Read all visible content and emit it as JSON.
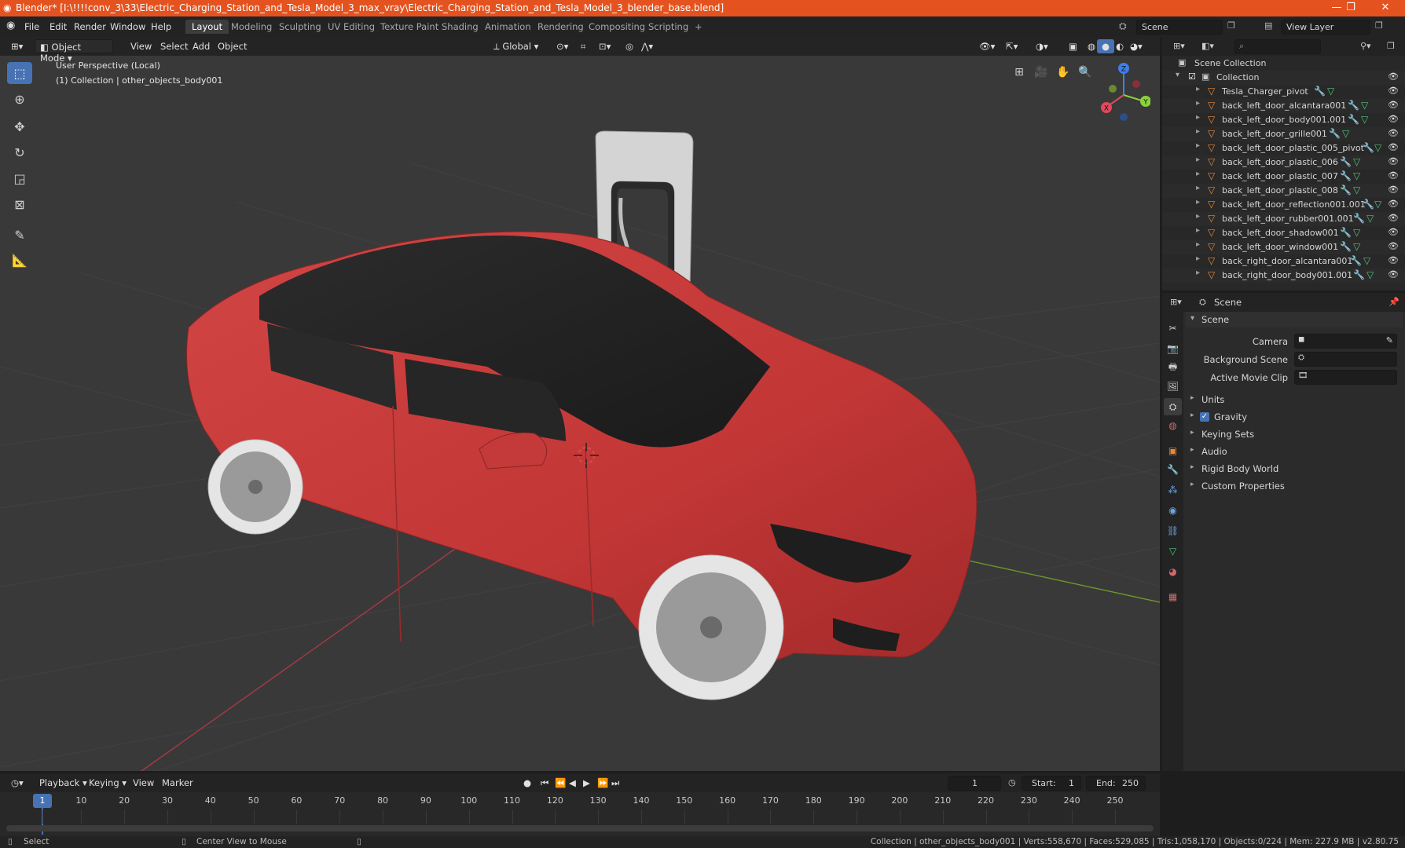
{
  "window": {
    "title": "Blender* [I:\\!!!!conv_3\\33\\Electric_Charging_Station_and_Tesla_Model_3_max_vray\\Electric_Charging_Station_and_Tesla_Model_3_blender_base.blend]",
    "minimize": "—",
    "maximize": "❐",
    "close": "✕"
  },
  "menu": {
    "items": [
      "File",
      "Edit",
      "Render",
      "Window",
      "Help"
    ],
    "workspaces": [
      "Layout",
      "Modeling",
      "Sculpting",
      "UV Editing",
      "Texture Paint",
      "Shading",
      "Animation",
      "Rendering",
      "Compositing",
      "Scripting"
    ],
    "add_tab": "+",
    "scene_label": "Scene",
    "view_layer_label": "View Layer"
  },
  "viewport": {
    "mode": "Object Mode",
    "menus": [
      "View",
      "Select",
      "Add",
      "Object"
    ],
    "transform_orientation": "Global",
    "perspective_label": "User Perspective (Local)",
    "collection_label": "(1) Collection | other_objects_body001",
    "gizmo_axes": {
      "x": "X",
      "y": "Y",
      "z": "Z"
    }
  },
  "outliner": {
    "root": "Scene Collection",
    "collection": "Collection",
    "objects": [
      "Tesla_Charger_pivot",
      "back_left_door_alcantara001",
      "back_left_door_body001.001",
      "back_left_door_grille001",
      "back_left_door_plastic_005_pivot",
      "back_left_door_plastic_006",
      "back_left_door_plastic_007",
      "back_left_door_plastic_008",
      "back_left_door_reflection001.001",
      "back_left_door_rubber001.001",
      "back_left_door_shadow001",
      "back_left_door_window001",
      "back_right_door_alcantara001",
      "back_right_door_body001.001"
    ]
  },
  "properties": {
    "header": "Scene",
    "panel_title": "Scene",
    "fields": {
      "camera": "Camera",
      "background_scene": "Background Scene",
      "active_movie_clip": "Active Movie Clip"
    },
    "sections": [
      "Units",
      "Gravity",
      "Keying Sets",
      "Audio",
      "Rigid Body World",
      "Custom Properties"
    ],
    "gravity_checked": true
  },
  "timeline": {
    "menus": [
      "Playback",
      "Keying",
      "View",
      "Marker"
    ],
    "current_frame": "1",
    "start_label": "Start:",
    "start": "1",
    "end_label": "End:",
    "end": "250",
    "ticks": [
      "1",
      "10",
      "20",
      "30",
      "40",
      "50",
      "60",
      "70",
      "80",
      "90",
      "100",
      "110",
      "120",
      "130",
      "140",
      "150",
      "160",
      "170",
      "180",
      "190",
      "200",
      "210",
      "220",
      "230",
      "240",
      "250"
    ]
  },
  "status": {
    "left": "Select",
    "middle": "Center View to Mouse",
    "right": "Collection | other_objects_body001 | Verts:558,670 | Faces:529,085 | Tris:1,058,170 | Objects:0/224 | Mem: 227.9 MB | v2.80.75"
  },
  "colors": {
    "title_bar": "#e4531f",
    "accent": "#4772b3",
    "car_body": "#c93a3a",
    "axis_x": "#e04a5c",
    "axis_y": "#8bd13c",
    "axis_z": "#3f7ee8"
  }
}
